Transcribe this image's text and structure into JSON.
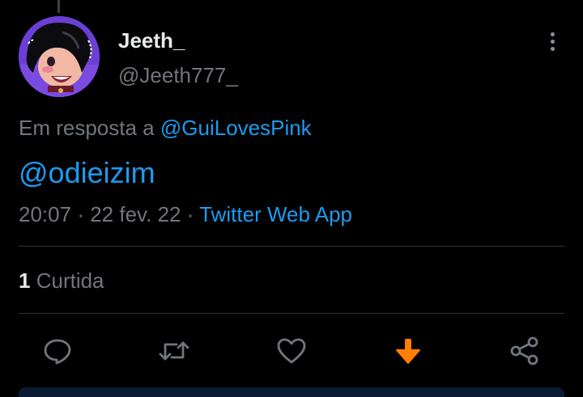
{
  "author": {
    "display_name": "Jeeth_",
    "handle": "@Jeeth777_"
  },
  "reply_context": {
    "prefix": "Em resposta a",
    "mention": "@GuiLovesPink"
  },
  "tweet": {
    "text": "@odieizim",
    "time": "20:07",
    "date": "22 fev. 22",
    "source": "Twitter Web App"
  },
  "engagement": {
    "likes_count": "1",
    "likes_label": "Curtida"
  },
  "actions": [
    {
      "name": "reply",
      "icon": "reply-icon"
    },
    {
      "name": "retweet",
      "icon": "retweet-icon"
    },
    {
      "name": "like",
      "icon": "heart-icon"
    },
    {
      "name": "download",
      "icon": "download-arrow-icon"
    },
    {
      "name": "share",
      "icon": "share-icon"
    }
  ],
  "colors": {
    "background": "#000000",
    "accent": "#1d9bf0",
    "muted_text": "#71767b",
    "primary_text": "#e7e9ea",
    "divider": "#2f3336",
    "download_icon": "#ff7f00"
  }
}
